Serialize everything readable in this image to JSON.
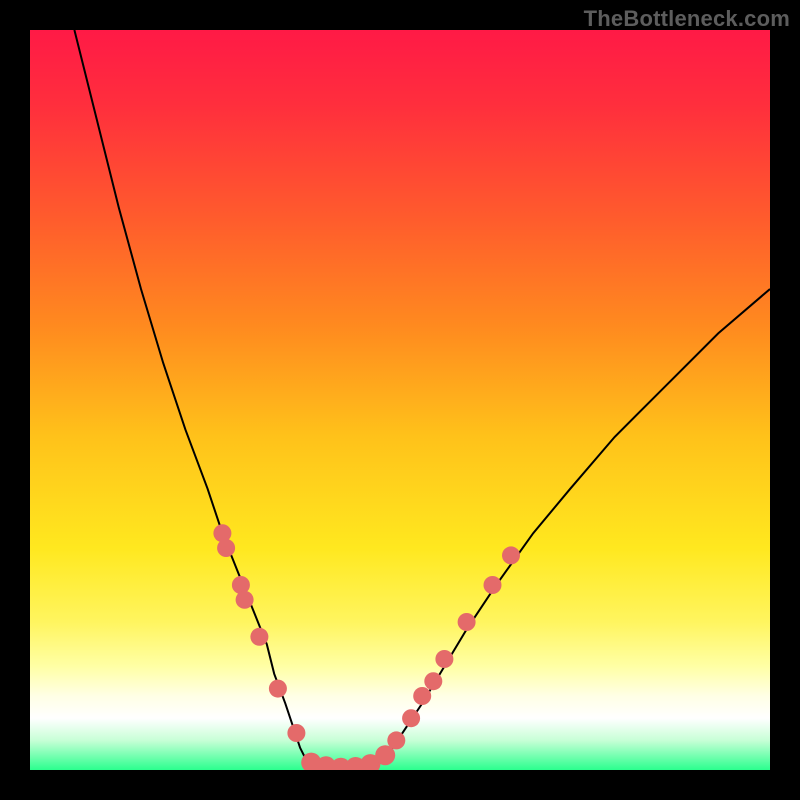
{
  "watermark": {
    "text": "TheBottleneck.com"
  },
  "colors": {
    "frame": "#000000",
    "gradient_stops": [
      {
        "offset": 0.0,
        "color": "#ff1a46"
      },
      {
        "offset": 0.1,
        "color": "#ff2e3d"
      },
      {
        "offset": 0.25,
        "color": "#ff5a2d"
      },
      {
        "offset": 0.4,
        "color": "#ff8a1f"
      },
      {
        "offset": 0.55,
        "color": "#ffc21a"
      },
      {
        "offset": 0.7,
        "color": "#ffe81f"
      },
      {
        "offset": 0.8,
        "color": "#fff55f"
      },
      {
        "offset": 0.86,
        "color": "#ffffa5"
      },
      {
        "offset": 0.9,
        "color": "#ffffe5"
      },
      {
        "offset": 0.93,
        "color": "#ffffff"
      },
      {
        "offset": 0.96,
        "color": "#c7ffd6"
      },
      {
        "offset": 1.0,
        "color": "#2bff8e"
      }
    ],
    "curve": "#000000",
    "markers_fill": "#e46a6a",
    "markers_stroke": "#c84f4f"
  },
  "chart_data": {
    "type": "line",
    "title": "",
    "xlabel": "",
    "ylabel": "",
    "xlim": [
      0,
      100
    ],
    "ylim": [
      0,
      100
    ],
    "grid": false,
    "series": [
      {
        "name": "bottleneck-curve-left",
        "x": [
          6,
          9,
          12,
          15,
          18,
          21,
          24,
          26,
          28,
          30,
          32,
          33,
          34.5,
          35.5,
          36.5,
          37.5
        ],
        "y": [
          100,
          88,
          76,
          65,
          55,
          46,
          38,
          32,
          27,
          22,
          17,
          13,
          9,
          6,
          3,
          1
        ]
      },
      {
        "name": "bottleneck-curve-flat",
        "x": [
          37.5,
          39,
          40.5,
          42.5,
          44.5,
          46,
          47.5
        ],
        "y": [
          1,
          0.5,
          0.3,
          0.2,
          0.3,
          0.5,
          1
        ]
      },
      {
        "name": "bottleneck-curve-right",
        "x": [
          47.5,
          49,
          51,
          53,
          56,
          59,
          63,
          68,
          73,
          79,
          86,
          93,
          100
        ],
        "y": [
          1,
          3,
          6,
          9,
          14,
          19,
          25,
          32,
          38,
          45,
          52,
          59,
          65
        ]
      }
    ],
    "markers": [
      {
        "x": 26,
        "y": 32,
        "r": 9
      },
      {
        "x": 26.5,
        "y": 30,
        "r": 9
      },
      {
        "x": 28.5,
        "y": 25,
        "r": 9
      },
      {
        "x": 29,
        "y": 23,
        "r": 9
      },
      {
        "x": 31,
        "y": 18,
        "r": 9
      },
      {
        "x": 33.5,
        "y": 11,
        "r": 9
      },
      {
        "x": 36,
        "y": 5,
        "r": 9
      },
      {
        "x": 38,
        "y": 1,
        "r": 10
      },
      {
        "x": 40,
        "y": 0.5,
        "r": 10
      },
      {
        "x": 42,
        "y": 0.3,
        "r": 10
      },
      {
        "x": 44,
        "y": 0.4,
        "r": 10
      },
      {
        "x": 46,
        "y": 0.8,
        "r": 10
      },
      {
        "x": 48,
        "y": 2,
        "r": 10
      },
      {
        "x": 49.5,
        "y": 4,
        "r": 9
      },
      {
        "x": 51.5,
        "y": 7,
        "r": 9
      },
      {
        "x": 53,
        "y": 10,
        "r": 9
      },
      {
        "x": 54.5,
        "y": 12,
        "r": 9
      },
      {
        "x": 56,
        "y": 15,
        "r": 9
      },
      {
        "x": 59,
        "y": 20,
        "r": 9
      },
      {
        "x": 62.5,
        "y": 25,
        "r": 9
      },
      {
        "x": 65,
        "y": 29,
        "r": 9
      }
    ]
  }
}
